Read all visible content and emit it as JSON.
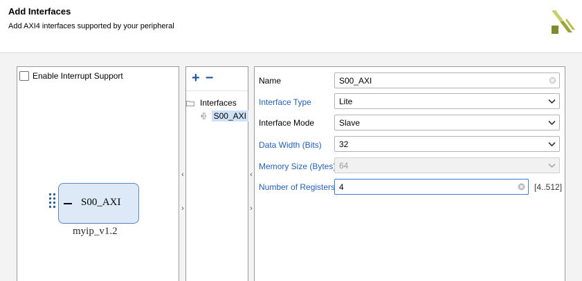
{
  "header": {
    "title": "Add Interfaces",
    "subtitle": "Add AXI4 interfaces supported by your peripheral",
    "logo_icon": "xilinx-logo",
    "logo_color": "#9aa536"
  },
  "left_panel": {
    "interrupt_checkbox_label": "Enable Interrupt Support",
    "interrupt_checked": false,
    "ip_block_port": "S00_AXI",
    "ip_block_caption": "myip_v1.2"
  },
  "mid_panel": {
    "add_label": "+",
    "remove_label": "−",
    "tree_root": "Interfaces",
    "tree_items": [
      "S00_AXI"
    ]
  },
  "collapse": {
    "left_arrow": "‹",
    "right_arrow": "›"
  },
  "form": {
    "name_label": "Name",
    "name_value": "S00_AXI",
    "interface_type_label": "Interface Type",
    "interface_type_value": "Lite",
    "interface_mode_label": "Interface Mode",
    "interface_mode_value": "Slave",
    "data_width_label": "Data Width (Bits)",
    "data_width_value": "32",
    "memory_size_label": "Memory Size (Bytes)",
    "memory_size_value": "64",
    "num_registers_label": "Number of Registers",
    "num_registers_value": "4",
    "num_registers_range": "[4..512]"
  },
  "colors": {
    "link_label": "#2560b6",
    "selection": "#cfe1f6",
    "ip_block_fill": "#dde9f7",
    "focus_border": "#3b78d0"
  }
}
